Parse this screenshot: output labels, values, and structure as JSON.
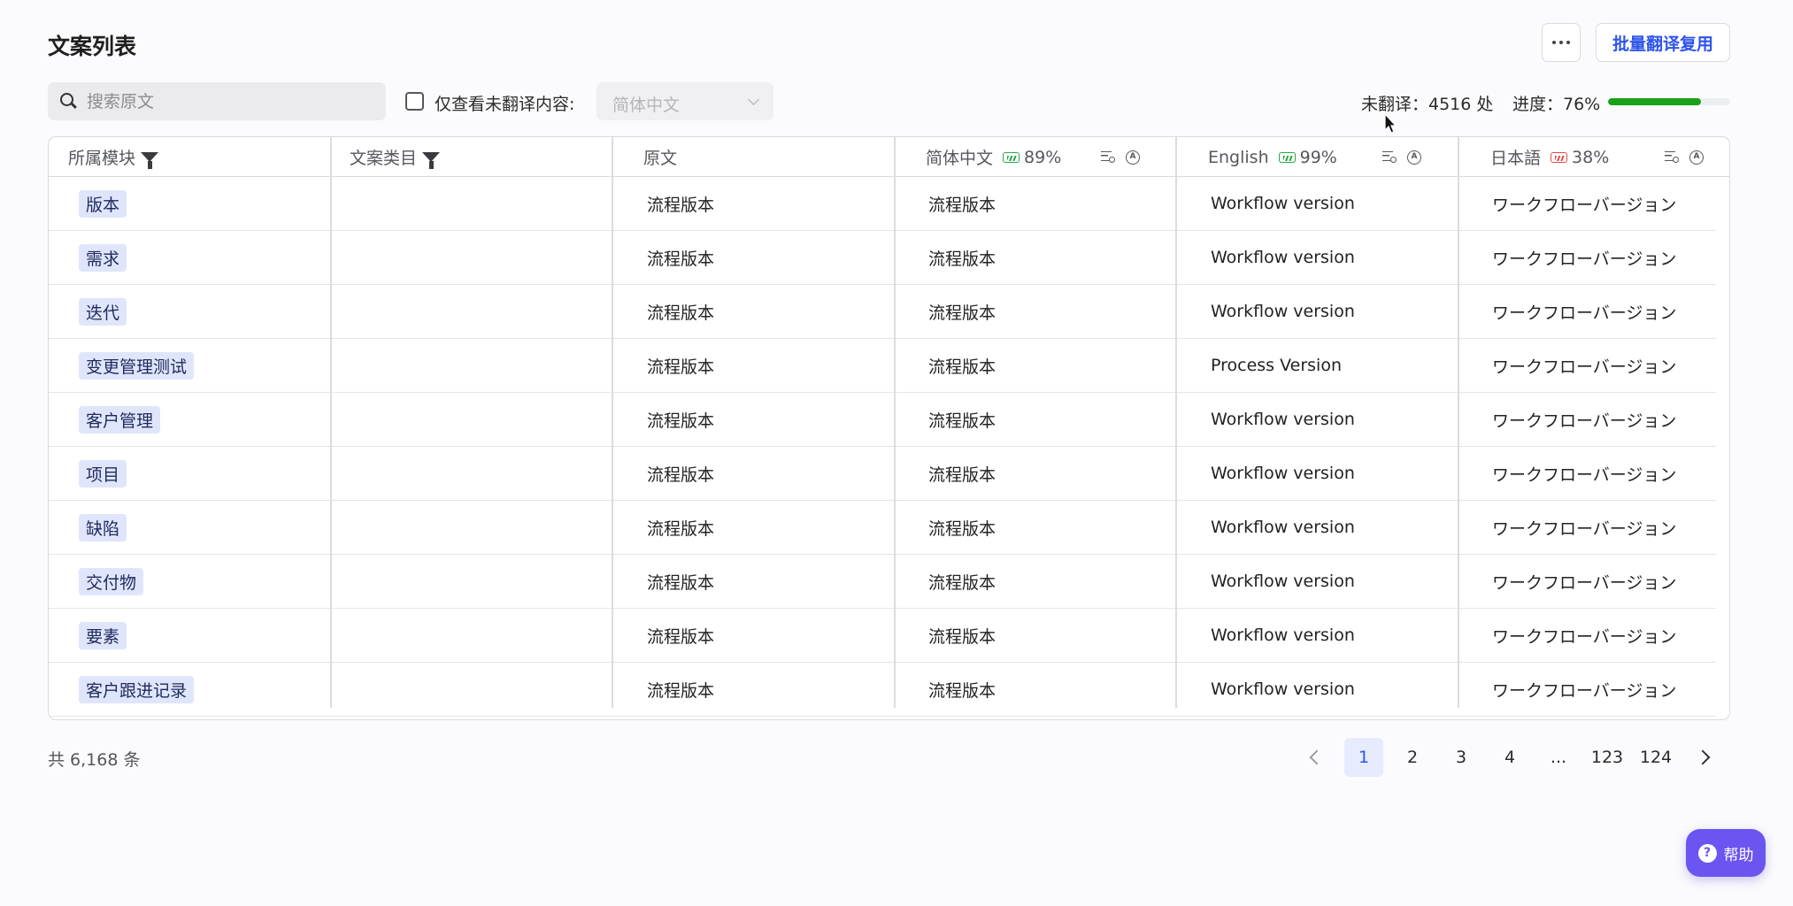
{
  "header": {
    "title": "文案列表",
    "batch_button": "批量翻译复用"
  },
  "toolbar": {
    "search_placeholder": "搜索原文",
    "untranslated_only_label": "仅查看未翻译内容:",
    "language_select_value": "简体中文",
    "untranslated_stat": "未翻译：4516 处",
    "progress_label": "进度：76%",
    "progress_value": 0.76
  },
  "table": {
    "columns": {
      "module": "所属模块",
      "category": "文案类目",
      "source": "原文",
      "zh": {
        "label": "简体中文",
        "percent": "89%"
      },
      "en": {
        "label": "English",
        "percent": "99%"
      },
      "ja": {
        "label": "日本語",
        "percent": "38%"
      }
    },
    "rows": [
      {
        "module": "版本",
        "category": "",
        "source": "流程版本",
        "zh": "流程版本",
        "en": "Workflow version",
        "ja": "ワークフローバージョン"
      },
      {
        "module": "需求",
        "category": "",
        "source": "流程版本",
        "zh": "流程版本",
        "en": "Workflow version",
        "ja": "ワークフローバージョン"
      },
      {
        "module": "迭代",
        "category": "",
        "source": "流程版本",
        "zh": "流程版本",
        "en": "Workflow version",
        "ja": "ワークフローバージョン"
      },
      {
        "module": "变更管理测试",
        "category": "",
        "source": "流程版本",
        "zh": "流程版本",
        "en": "Process Version",
        "ja": "ワークフローバージョン"
      },
      {
        "module": "客户管理",
        "category": "",
        "source": "流程版本",
        "zh": "流程版本",
        "en": "Workflow version",
        "ja": "ワークフローバージョン"
      },
      {
        "module": "项目",
        "category": "",
        "source": "流程版本",
        "zh": "流程版本",
        "en": "Workflow version",
        "ja": "ワークフローバージョン"
      },
      {
        "module": "缺陷",
        "category": "",
        "source": "流程版本",
        "zh": "流程版本",
        "en": "Workflow version",
        "ja": "ワークフローバージョン"
      },
      {
        "module": "交付物",
        "category": "",
        "source": "流程版本",
        "zh": "流程版本",
        "en": "Workflow version",
        "ja": "ワークフローバージョン"
      },
      {
        "module": "要素",
        "category": "",
        "source": "流程版本",
        "zh": "流程版本",
        "en": "Workflow version",
        "ja": "ワークフローバージョン"
      },
      {
        "module": "客户跟进记录",
        "category": "",
        "source": "流程版本",
        "zh": "流程版本",
        "en": "Workflow version",
        "ja": "ワークフローバージョン"
      }
    ]
  },
  "footer": {
    "total": "共 6,168 条",
    "pages": [
      "1",
      "2",
      "3",
      "4",
      "...",
      "123",
      "124"
    ],
    "active_page": "1"
  },
  "help_button": "帮助",
  "colors": {
    "accent": "#2f54eb",
    "progress": "#19a119",
    "tag_bg": "#dfe6fb",
    "help_bg": "#6b55f0"
  }
}
